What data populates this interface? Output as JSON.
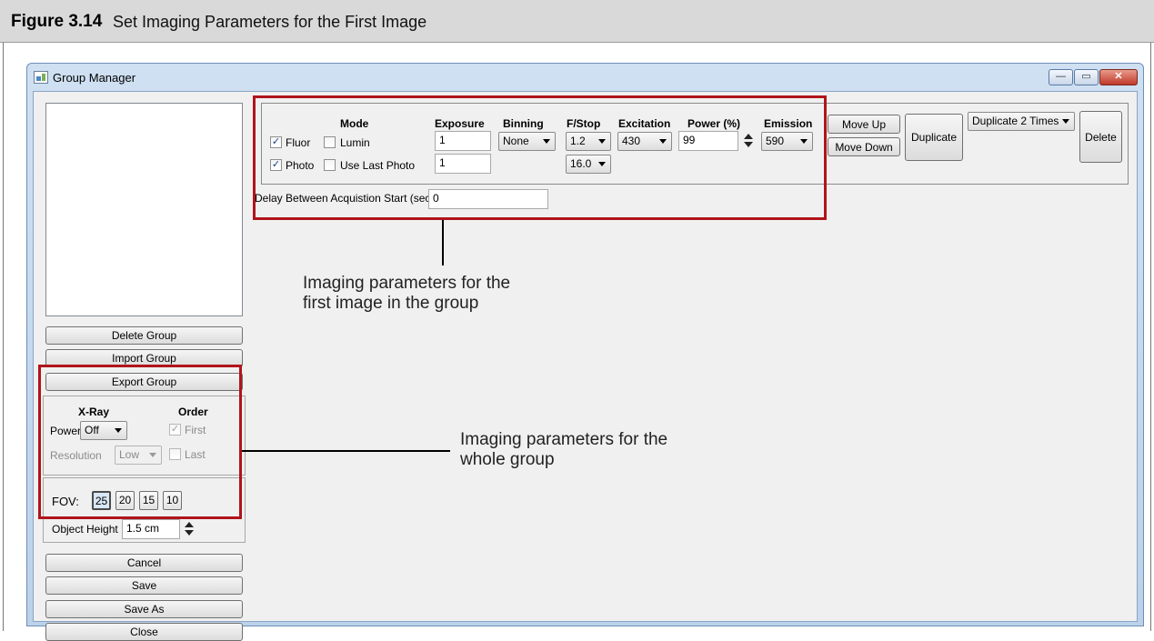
{
  "figure": {
    "number": "Figure 3.14",
    "title": "Set Imaging Parameters for the First Image"
  },
  "window": {
    "title": "Group Manager",
    "controls": {
      "minimize": "—",
      "maximize": "▭",
      "close": "✕"
    }
  },
  "sidebar": {
    "buttons": {
      "delete_group": "Delete Group",
      "import_group": "Import Group",
      "export_group": "Export Group"
    },
    "xray": {
      "heading": "X-Ray",
      "power_label": "Power",
      "power_value": "Off",
      "resolution_label": "Resolution",
      "resolution_value": "Low"
    },
    "order": {
      "heading": "Order",
      "first_label": "First",
      "first_checked": true,
      "last_label": "Last",
      "last_checked": false
    },
    "fov": {
      "label": "FOV:",
      "options": [
        "25",
        "20",
        "15",
        "10"
      ],
      "selected": "25"
    },
    "object_height": {
      "label": "Object Height",
      "value": "1.5 cm"
    },
    "bottom_buttons": {
      "cancel": "Cancel",
      "save": "Save",
      "save_as": "Save As",
      "close": "Close"
    }
  },
  "params": {
    "headers": {
      "mode": "Mode",
      "exposure": "Exposure",
      "binning": "Binning",
      "fstop": "F/Stop",
      "excitation": "Excitation",
      "power": "Power (%)",
      "emission": "Emission"
    },
    "fluor": {
      "label": "Fluor",
      "checked": true
    },
    "lumin": {
      "label": "Lumin",
      "checked": false
    },
    "photo": {
      "label": "Photo",
      "checked": true
    },
    "use_last_photo": {
      "label": "Use Last Photo",
      "checked": false
    },
    "exposure_fluor": "1",
    "exposure_photo": "1",
    "binning": "None",
    "fstop_fluor": "1.2",
    "fstop_photo": "16.0",
    "excitation": "430",
    "power": "99",
    "emission": "590",
    "delay_label": "Delay Between Acquistion Start (sec)",
    "delay_value": "0"
  },
  "actions": {
    "move_up": "Move Up",
    "move_down": "Move Down",
    "duplicate": "Duplicate",
    "duplicate_times": "Duplicate  2 Times",
    "delete": "Delete"
  },
  "callouts": {
    "first_image": "Imaging parameters for the\nfirst image in the group",
    "whole_group": "Imaging parameters for the\nwhole group"
  },
  "colors": {
    "highlight_box": "#b0141b",
    "window_frame": "#bcd2ea"
  }
}
